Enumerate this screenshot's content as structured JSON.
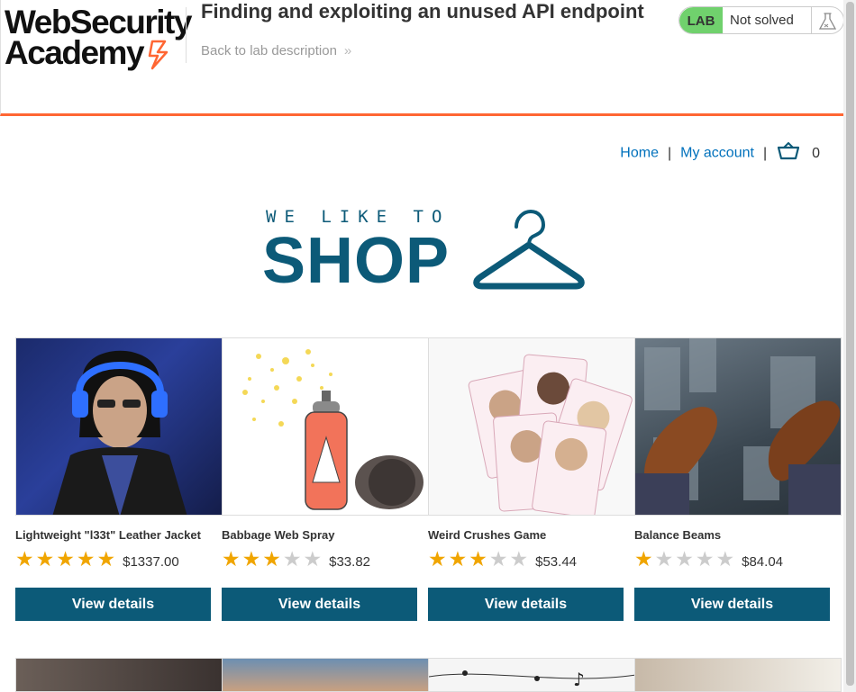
{
  "header": {
    "logo_line1": "WebSecurity",
    "logo_line2": "Academy",
    "lab_title": "Finding and exploiting an unused API endpoint",
    "back_link": "Back to lab description",
    "status_label": "LAB",
    "status_text": "Not solved"
  },
  "nav": {
    "home": "Home",
    "separator": "|",
    "my_account": "My account",
    "cart_count": "0"
  },
  "banner": {
    "small": "WE LIKE TO",
    "big": "SHOP"
  },
  "products": [
    {
      "name": "Lightweight \"l33t\" Leather Jacket",
      "rating": 5,
      "price": "$1337.00",
      "button": "View details"
    },
    {
      "name": "Babbage Web Spray",
      "rating": 3,
      "price": "$33.82",
      "button": "View details"
    },
    {
      "name": "Weird Crushes Game",
      "rating": 3,
      "price": "$53.44",
      "button": "View details"
    },
    {
      "name": "Balance Beams",
      "rating": 1,
      "price": "$84.04",
      "button": "View details"
    }
  ],
  "colors": {
    "accent": "#ff6633",
    "brand": "#0c5a78",
    "link": "#0071bc",
    "status_green": "#70d16d",
    "star": "#f0a500"
  },
  "icons": [
    "flask-icon",
    "cart-icon",
    "hanger-icon",
    "star-icon",
    "chevron-right-icon"
  ]
}
